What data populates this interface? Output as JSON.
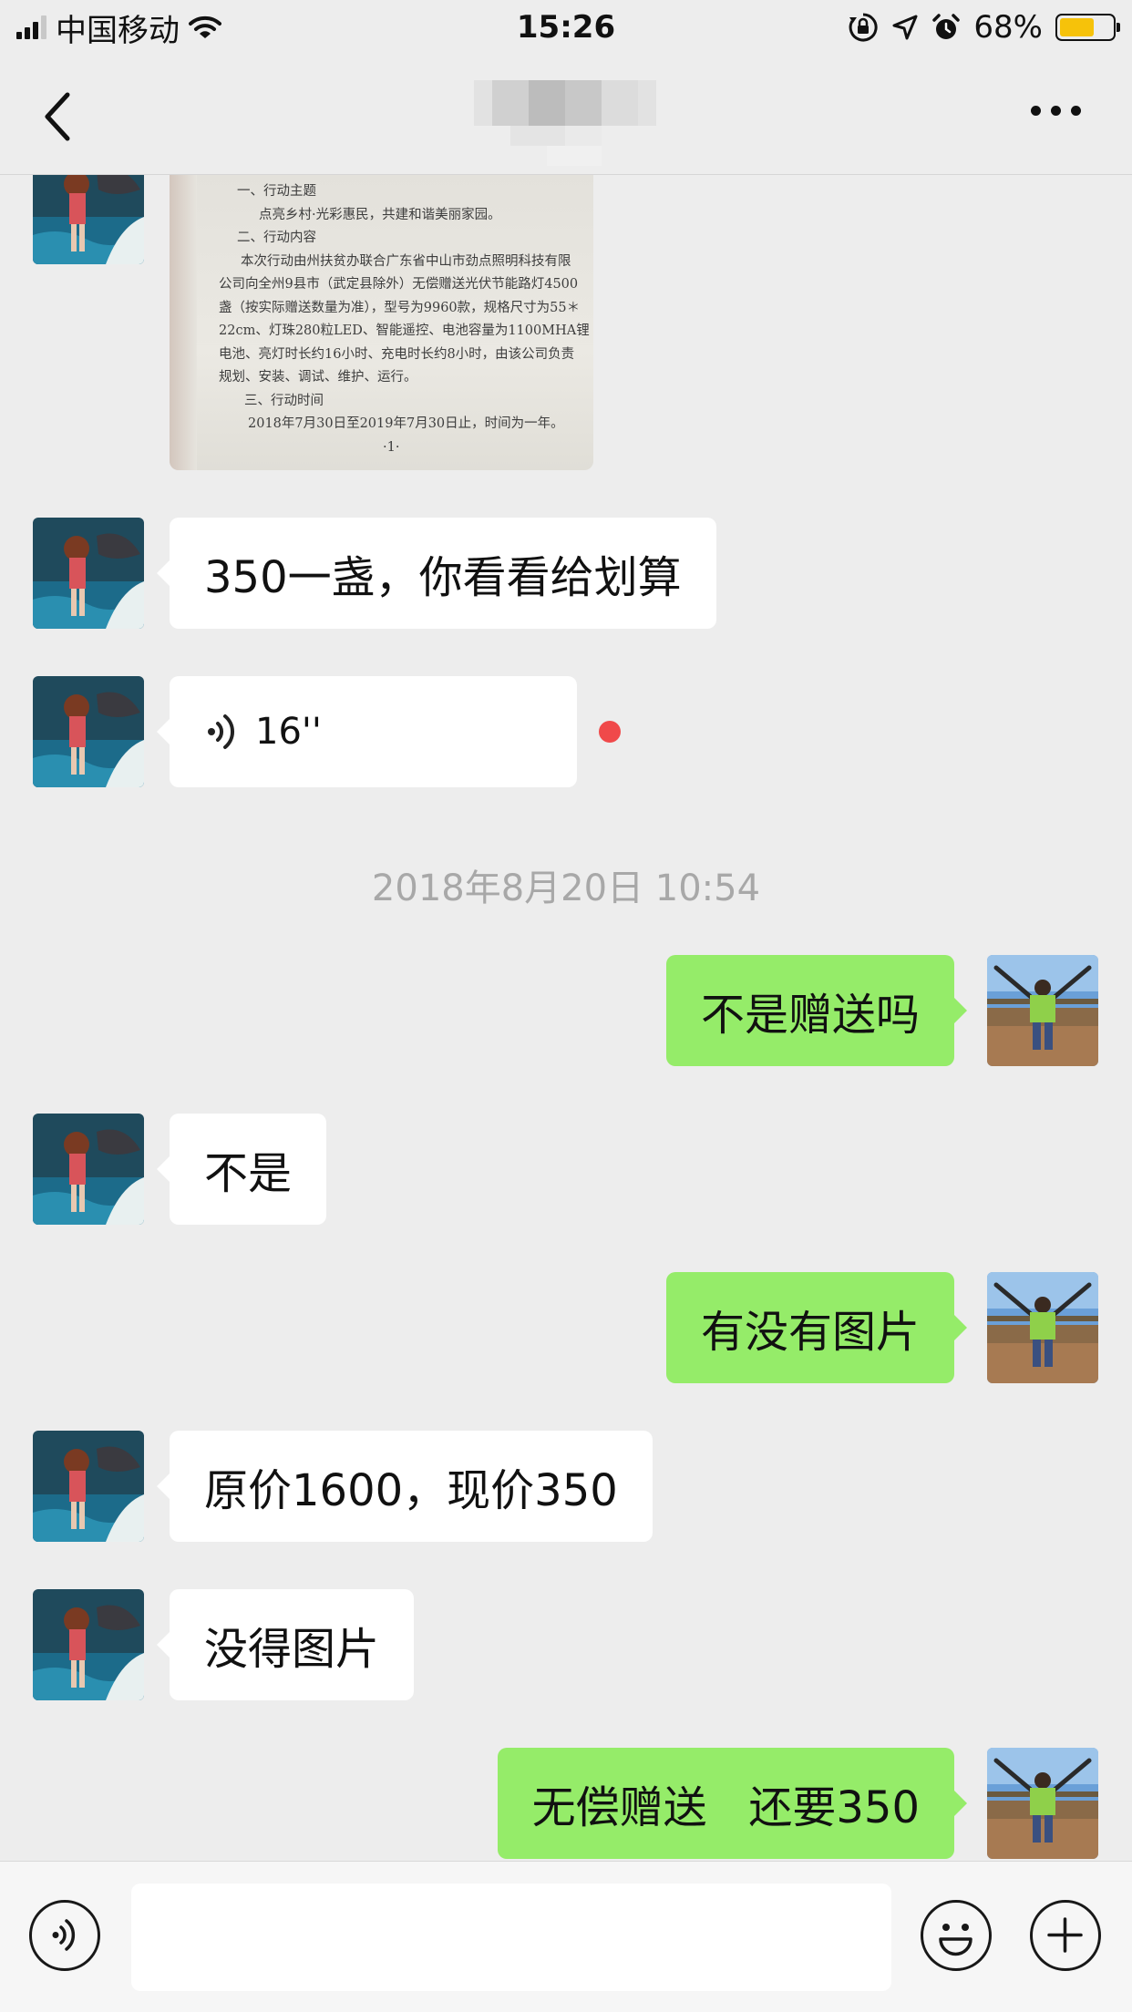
{
  "status_bar": {
    "carrier": "中国移动",
    "time": "15:26",
    "battery_percent": "68%",
    "battery_level": 0.68,
    "icons": [
      "signal-icon",
      "wifi-icon",
      "orientation-lock-icon",
      "location-icon",
      "alarm-icon",
      "battery-icon"
    ]
  },
  "nav": {
    "back_icon": "chevron-left-icon",
    "more_icon": "more-dots-icon"
  },
  "document_image": {
    "lines": [
      "一、行动主题",
      "点亮乡村·光彩惠民，共建和谐美丽家园。",
      "二、行动内容",
      "本次行动由州扶贫办联合广东省中山市劲点照明科技有限",
      "公司向全州9县市（武定县除外）无偿赠送光伏节能路灯4500",
      "盏（按实际赠送数量为准），型号为9960款，规格尺寸为55＊",
      "22cm、灯珠280粒LED、智能遥控、电池容量为1100MHA锂",
      "电池、亮灯时长约16小时、充电时长约8小时，由该公司负责",
      "规划、安装、调试、维护、运行。",
      "三、行动时间",
      "2018年7月30日至2019年7月30日止，时间为一年。",
      "·1·"
    ]
  },
  "messages": {
    "m1": "350一盏，你看看给划算",
    "voice_duration": "16''",
    "timestamp": "2018年8月20日 10:54",
    "m2": "不是赠送吗",
    "m3": "不是",
    "m4": "有没有图片",
    "m5": "原价1600，现价350",
    "m6": "没得图片",
    "m7": "无偿赠送   还要350"
  },
  "input_bar": {
    "voice_icon": "voice-input-icon",
    "emoji_icon": "emoji-icon",
    "plus_icon": "plus-icon",
    "text": ""
  },
  "colors": {
    "background": "#ededed",
    "bubble_out": "#95ec69",
    "bubble_in": "#ffffff",
    "unread_dot": "#f0494a",
    "battery": "#f6c20a"
  }
}
